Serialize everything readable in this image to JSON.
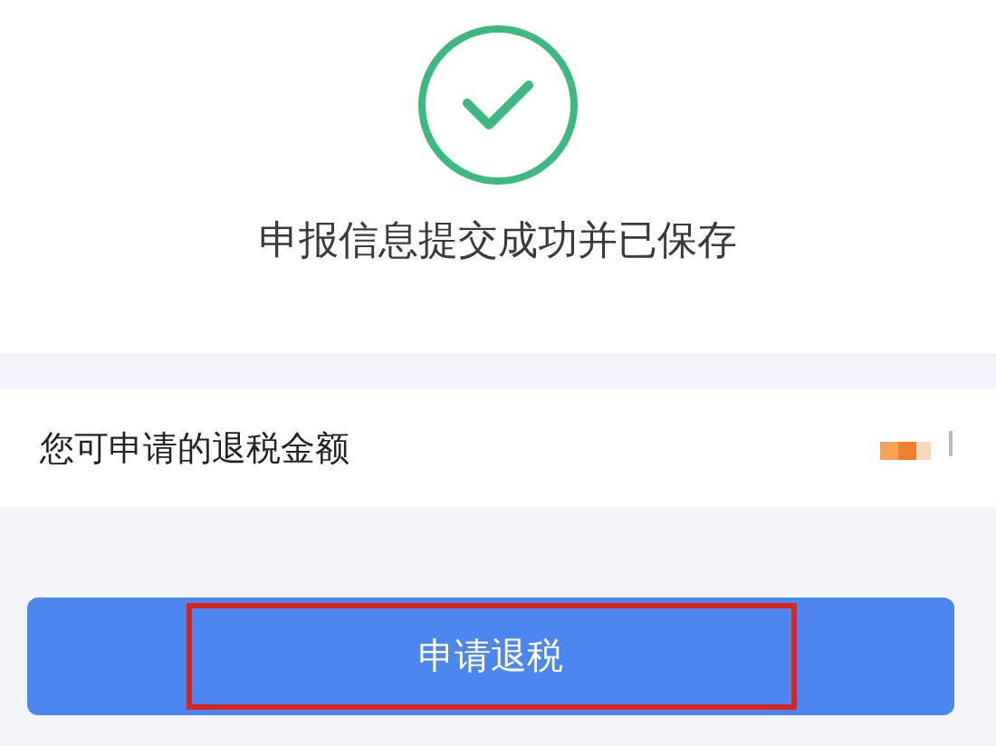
{
  "result": {
    "message": "申报信息提交成功并已保存"
  },
  "refund_row": {
    "label": "您可申请的退税金额"
  },
  "apply_button": {
    "label": "申请退税",
    "highlighted": true
  }
}
